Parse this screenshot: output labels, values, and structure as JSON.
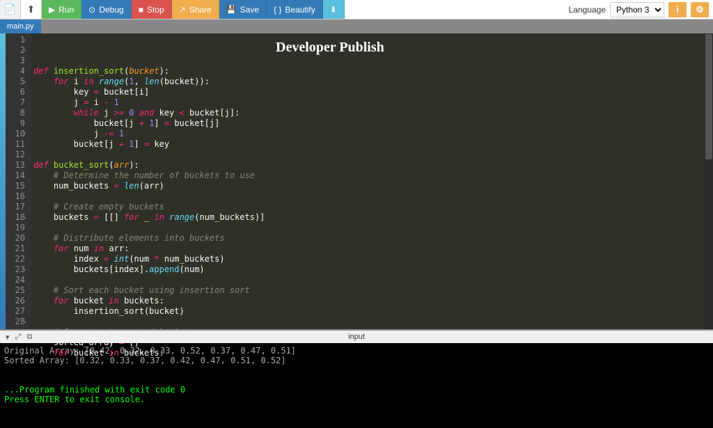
{
  "toolbar": {
    "run": "Run",
    "debug": "Debug",
    "stop": "Stop",
    "share": "Share",
    "save": "Save",
    "beautify": "Beautify",
    "language_label": "Language",
    "language_value": "Python 3"
  },
  "tabs": {
    "main": "main.py"
  },
  "watermark": "Developer Publish",
  "gutter": [
    "1",
    "2",
    "3",
    "4",
    "5",
    "6",
    "7",
    "8",
    "9",
    "10",
    "11",
    "12",
    "13",
    "14",
    "15",
    "16",
    "17",
    "18",
    "19",
    "20",
    "21",
    "22",
    "23",
    "24",
    "25",
    "26",
    "27",
    "28"
  ],
  "code_lines": [
    {
      "indent": 0,
      "tokens": [
        {
          "c": "kw",
          "t": "def"
        },
        {
          "c": "",
          "t": " "
        },
        {
          "c": "de",
          "t": "insertion_sort"
        },
        {
          "c": "",
          "t": "("
        },
        {
          "c": "pa",
          "t": "bucket"
        },
        {
          "c": "",
          "t": "):"
        }
      ]
    },
    {
      "indent": 1,
      "tokens": [
        {
          "c": "kw",
          "t": "for"
        },
        {
          "c": "",
          "t": " i "
        },
        {
          "c": "kw",
          "t": "in"
        },
        {
          "c": "",
          "t": " "
        },
        {
          "c": "bi",
          "t": "range"
        },
        {
          "c": "",
          "t": "("
        },
        {
          "c": "nm",
          "t": "1"
        },
        {
          "c": "",
          "t": ", "
        },
        {
          "c": "bi",
          "t": "len"
        },
        {
          "c": "",
          "t": "(bucket)):"
        }
      ]
    },
    {
      "indent": 2,
      "tokens": [
        {
          "c": "",
          "t": "key "
        },
        {
          "c": "op",
          "t": "="
        },
        {
          "c": "",
          "t": " bucket[i]"
        }
      ]
    },
    {
      "indent": 2,
      "tokens": [
        {
          "c": "",
          "t": "j "
        },
        {
          "c": "op",
          "t": "="
        },
        {
          "c": "",
          "t": " i "
        },
        {
          "c": "op",
          "t": "-"
        },
        {
          "c": "",
          "t": " "
        },
        {
          "c": "nm",
          "t": "1"
        }
      ]
    },
    {
      "indent": 2,
      "tokens": [
        {
          "c": "kw",
          "t": "while"
        },
        {
          "c": "",
          "t": " j "
        },
        {
          "c": "op",
          "t": ">="
        },
        {
          "c": "",
          "t": " "
        },
        {
          "c": "nm",
          "t": "0"
        },
        {
          "c": "",
          "t": " "
        },
        {
          "c": "kw",
          "t": "and"
        },
        {
          "c": "",
          "t": " key "
        },
        {
          "c": "op",
          "t": "<"
        },
        {
          "c": "",
          "t": " bucket[j]:"
        }
      ]
    },
    {
      "indent": 3,
      "tokens": [
        {
          "c": "",
          "t": "bucket[j "
        },
        {
          "c": "op",
          "t": "+"
        },
        {
          "c": "",
          "t": " "
        },
        {
          "c": "nm",
          "t": "1"
        },
        {
          "c": "",
          "t": "] "
        },
        {
          "c": "op",
          "t": "="
        },
        {
          "c": "",
          "t": " bucket[j]"
        }
      ]
    },
    {
      "indent": 3,
      "tokens": [
        {
          "c": "",
          "t": "j "
        },
        {
          "c": "op",
          "t": "-="
        },
        {
          "c": "",
          "t": " "
        },
        {
          "c": "nm",
          "t": "1"
        }
      ]
    },
    {
      "indent": 2,
      "tokens": [
        {
          "c": "",
          "t": "bucket[j "
        },
        {
          "c": "op",
          "t": "+"
        },
        {
          "c": "",
          "t": " "
        },
        {
          "c": "nm",
          "t": "1"
        },
        {
          "c": "",
          "t": "] "
        },
        {
          "c": "op",
          "t": "="
        },
        {
          "c": "",
          "t": " key"
        }
      ]
    },
    {
      "indent": 0,
      "tokens": [
        {
          "c": "",
          "t": ""
        }
      ]
    },
    {
      "indent": 0,
      "tokens": [
        {
          "c": "kw",
          "t": "def"
        },
        {
          "c": "",
          "t": " "
        },
        {
          "c": "de",
          "t": "bucket_sort"
        },
        {
          "c": "",
          "t": "("
        },
        {
          "c": "pa",
          "t": "arr"
        },
        {
          "c": "",
          "t": "):"
        }
      ]
    },
    {
      "indent": 1,
      "tokens": [
        {
          "c": "cm",
          "t": "# Determine the number of buckets to use"
        }
      ]
    },
    {
      "indent": 1,
      "tokens": [
        {
          "c": "",
          "t": "num_buckets "
        },
        {
          "c": "op",
          "t": "="
        },
        {
          "c": "",
          "t": " "
        },
        {
          "c": "bi",
          "t": "len"
        },
        {
          "c": "",
          "t": "(arr)"
        }
      ]
    },
    {
      "indent": 0,
      "tokens": [
        {
          "c": "",
          "t": ""
        }
      ]
    },
    {
      "indent": 1,
      "tokens": [
        {
          "c": "cm",
          "t": "# Create empty buckets"
        }
      ]
    },
    {
      "indent": 1,
      "tokens": [
        {
          "c": "",
          "t": "buckets "
        },
        {
          "c": "op",
          "t": "="
        },
        {
          "c": "",
          "t": " [[] "
        },
        {
          "c": "kw",
          "t": "for"
        },
        {
          "c": "",
          "t": " _ "
        },
        {
          "c": "kw",
          "t": "in"
        },
        {
          "c": "",
          "t": " "
        },
        {
          "c": "bi",
          "t": "range"
        },
        {
          "c": "",
          "t": "(num_buckets)]"
        }
      ]
    },
    {
      "indent": 0,
      "tokens": [
        {
          "c": "",
          "t": ""
        }
      ]
    },
    {
      "indent": 1,
      "tokens": [
        {
          "c": "cm",
          "t": "# Distribute elements into buckets"
        }
      ]
    },
    {
      "indent": 1,
      "tokens": [
        {
          "c": "kw",
          "t": "for"
        },
        {
          "c": "",
          "t": " num "
        },
        {
          "c": "kw",
          "t": "in"
        },
        {
          "c": "",
          "t": " arr:"
        }
      ]
    },
    {
      "indent": 2,
      "tokens": [
        {
          "c": "",
          "t": "index "
        },
        {
          "c": "op",
          "t": "="
        },
        {
          "c": "",
          "t": " "
        },
        {
          "c": "bi",
          "t": "int"
        },
        {
          "c": "",
          "t": "(num "
        },
        {
          "c": "op",
          "t": "*"
        },
        {
          "c": "",
          "t": " num_buckets)"
        }
      ]
    },
    {
      "indent": 2,
      "tokens": [
        {
          "c": "",
          "t": "buckets[index]."
        },
        {
          "c": "fn",
          "t": "append"
        },
        {
          "c": "",
          "t": "(num)"
        }
      ]
    },
    {
      "indent": 0,
      "tokens": [
        {
          "c": "",
          "t": ""
        }
      ]
    },
    {
      "indent": 1,
      "tokens": [
        {
          "c": "cm",
          "t": "# Sort each bucket using insertion sort"
        }
      ]
    },
    {
      "indent": 1,
      "tokens": [
        {
          "c": "kw",
          "t": "for"
        },
        {
          "c": "",
          "t": " bucket "
        },
        {
          "c": "kw",
          "t": "in"
        },
        {
          "c": "",
          "t": " buckets:"
        }
      ]
    },
    {
      "indent": 2,
      "tokens": [
        {
          "c": "",
          "t": "insertion_sort(bucket)"
        }
      ]
    },
    {
      "indent": 0,
      "tokens": [
        {
          "c": "",
          "t": ""
        }
      ]
    },
    {
      "indent": 1,
      "tokens": [
        {
          "c": "cm",
          "t": "# Concatenate sorted buckets"
        }
      ]
    },
    {
      "indent": 1,
      "tokens": [
        {
          "c": "",
          "t": "sorted_array "
        },
        {
          "c": "op",
          "t": "="
        },
        {
          "c": "",
          "t": " []"
        }
      ]
    },
    {
      "indent": 1,
      "tokens": [
        {
          "c": "kw",
          "t": "for"
        },
        {
          "c": "",
          "t": " bucket "
        },
        {
          "c": "kw",
          "t": "in"
        },
        {
          "c": "",
          "t": " buckets:"
        }
      ]
    }
  ],
  "foldable": [
    1,
    2,
    5,
    10,
    18,
    23,
    28
  ],
  "console": {
    "label": "input",
    "lines": [
      {
        "cls": "gray",
        "t": "Original Array: [0.42, 0.32, 0.33, 0.52, 0.37, 0.47, 0.51]"
      },
      {
        "cls": "gray",
        "t": "Sorted Array: [0.32, 0.33, 0.37, 0.42, 0.47, 0.51, 0.52]"
      },
      {
        "cls": "gray",
        "t": ""
      },
      {
        "cls": "gray",
        "t": ""
      },
      {
        "cls": "green",
        "t": "...Program finished with exit code 0"
      },
      {
        "cls": "green",
        "t": "Press ENTER to exit console."
      }
    ]
  }
}
